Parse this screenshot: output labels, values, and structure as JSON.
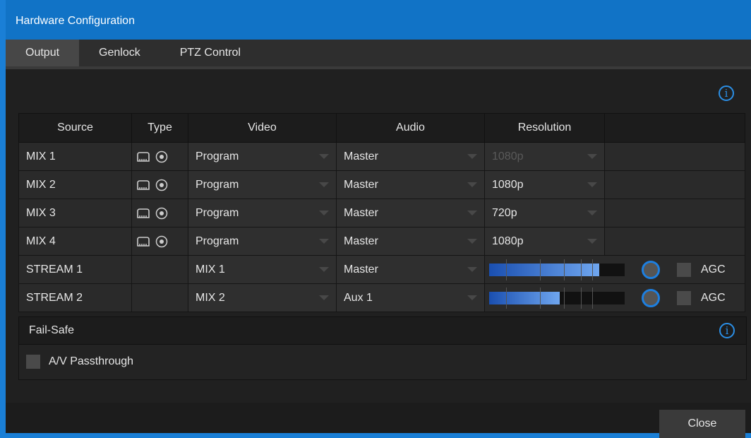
{
  "window": {
    "title": "Hardware Configuration"
  },
  "tabs": [
    {
      "label": "Output",
      "active": true
    },
    {
      "label": "Genlock",
      "active": false
    },
    {
      "label": "PTZ Control",
      "active": false
    }
  ],
  "table": {
    "headers": [
      "Source",
      "Type",
      "Video",
      "Audio",
      "Resolution"
    ],
    "rows": [
      {
        "source": "MIX 1",
        "type_icons": [
          "ndi-icon",
          "record-icon"
        ],
        "video": "Program",
        "audio": "Master",
        "resolution": "1080p",
        "resolution_disabled": true
      },
      {
        "source": "MIX 2",
        "type_icons": [
          "ndi-icon",
          "record-icon"
        ],
        "video": "Program",
        "audio": "Master",
        "resolution": "1080p"
      },
      {
        "source": "MIX 3",
        "type_icons": [
          "ndi-icon",
          "record-icon"
        ],
        "video": "Program",
        "audio": "Master",
        "resolution": "720p"
      },
      {
        "source": "MIX 4",
        "type_icons": [
          "ndi-icon",
          "record-icon"
        ],
        "video": "Program",
        "audio": "Master",
        "resolution": "1080p"
      },
      {
        "source": "STREAM 1",
        "video": "MIX 1",
        "audio": "Master",
        "meter_level": 0.81,
        "agc_label": "AGC",
        "agc_checked": false
      },
      {
        "source": "STREAM 2",
        "video": "MIX 2",
        "audio": "Aux 1",
        "meter_level": 0.52,
        "agc_label": "AGC",
        "agc_checked": false
      }
    ]
  },
  "failsafe": {
    "title": "Fail-Safe",
    "passthrough_label": "A/V Passthrough",
    "passthrough_checked": false
  },
  "footer": {
    "close_label": "Close"
  },
  "colors": {
    "accent": "#1173c6",
    "meter_fill_start": "#1a4fb0",
    "meter_fill_end": "#6fa6ef"
  }
}
